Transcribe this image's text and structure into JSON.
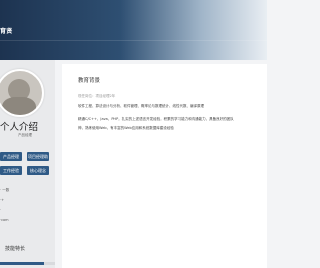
{
  "header": {
    "title": "育贤"
  },
  "profile": {
    "name": "个人介绍",
    "role": "产品经理",
    "buttons": [
      "产品经理",
      "项目经理助",
      "工作经验",
      "核心理念"
    ],
    "info": [
      "· 一数",
      "·+",
      "·",
      "·com"
    ]
  },
  "skills": {
    "title": "技能特长",
    "level": 0.8
  },
  "main": {
    "title": "教育背景",
    "subtitle": "现任岗位：项目经理2年",
    "paragraphs": [
      "软件工程、算法设计与分析、软件管理、概率论与数理统计、线性代数、编译原理",
      "精通C/C++、Java、PHP，扎实的上述语言开发经验，积累的学习能力和沟通能力，具备良好的团队",
      "神，熟练使用Web，有丰富的Web应用和系统数据库建设经验"
    ]
  }
}
